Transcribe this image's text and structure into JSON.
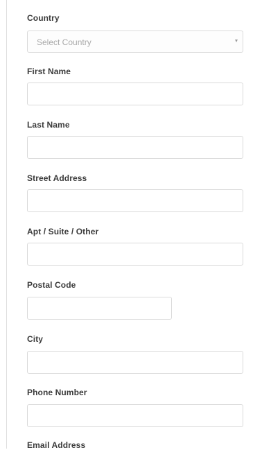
{
  "form": {
    "country": {
      "label": "Country",
      "placeholder": "Select Country"
    },
    "first_name": {
      "label": "First Name",
      "value": ""
    },
    "last_name": {
      "label": "Last Name",
      "value": ""
    },
    "street_address": {
      "label": "Street Address",
      "value": ""
    },
    "apt_suite": {
      "label": "Apt / Suite / Other",
      "value": ""
    },
    "postal_code": {
      "label": "Postal Code",
      "value": ""
    },
    "city": {
      "label": "City",
      "value": ""
    },
    "phone_number": {
      "label": "Phone Number",
      "value": ""
    },
    "email_address": {
      "label": "Email Address"
    }
  },
  "icons": {
    "country_select_caret": "chevron-down-icon"
  }
}
